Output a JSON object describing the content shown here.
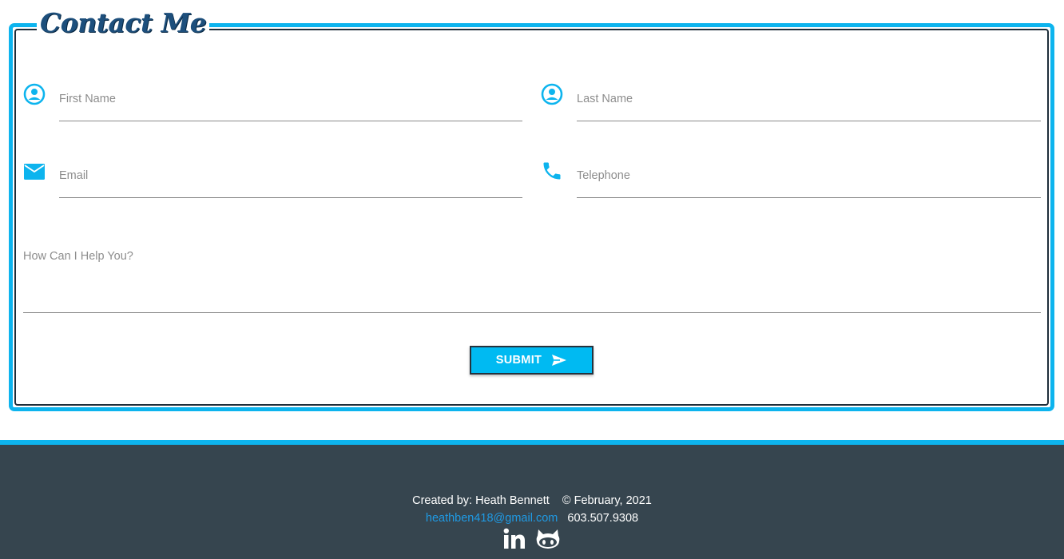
{
  "form": {
    "title": "Contact Me",
    "first_name": {
      "placeholder": "First Name",
      "icon": "account-circle-icon"
    },
    "last_name": {
      "placeholder": "Last Name",
      "icon": "account-circle-icon"
    },
    "email": {
      "placeholder": "Email",
      "icon": "email-icon"
    },
    "telephone": {
      "placeholder": "Telephone",
      "icon": "phone-icon"
    },
    "message": {
      "placeholder": "How Can I Help You?"
    },
    "submit_label": "SUBMIT",
    "submit_icon": "send-icon"
  },
  "footer": {
    "created_by": "Created by: Heath Bennett",
    "copyright": "© February, 2021",
    "email": "heathben418@gmail.com",
    "phone": "603.507.9308",
    "socials": [
      "linkedin-icon",
      "github-icon"
    ]
  },
  "colors": {
    "accent": "#0db4ee",
    "button": "#00baf2",
    "title": "#1d4f7c",
    "footer_bg": "#36454f",
    "link": "#1f9ae4"
  }
}
